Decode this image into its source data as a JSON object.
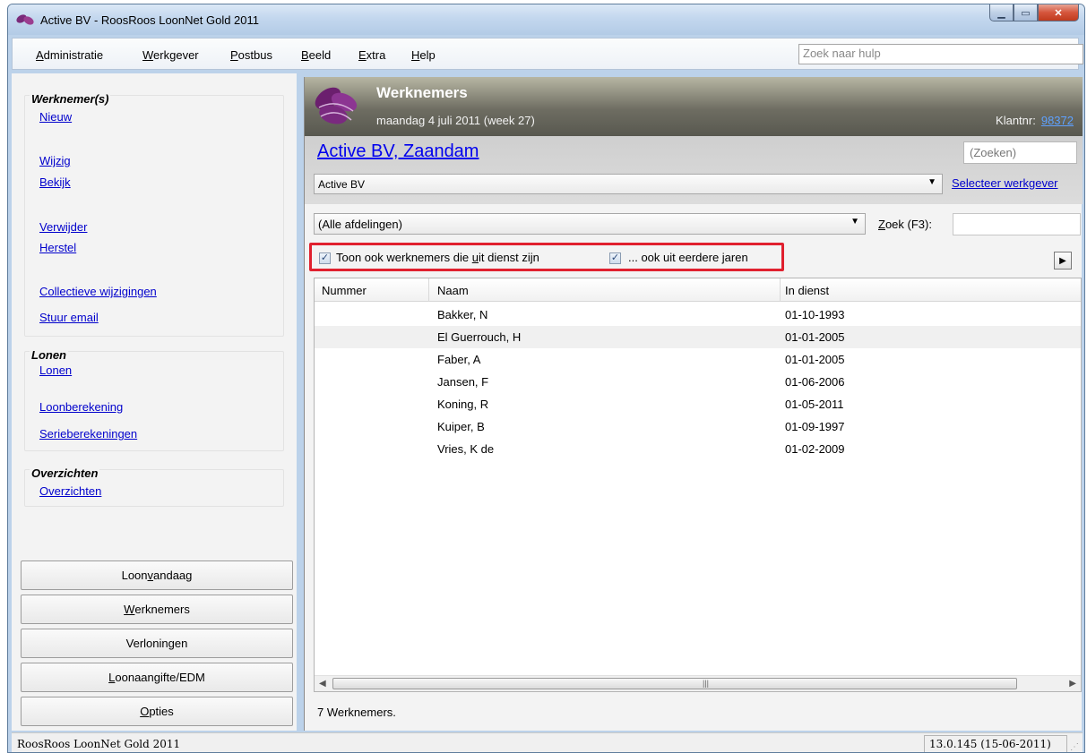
{
  "window": {
    "title": "Active BV - RoosRoos LoonNet Gold 2011"
  },
  "menu": {
    "items": [
      {
        "pre": "",
        "ul": "A",
        "post": "dministratie"
      },
      {
        "pre": "",
        "ul": "W",
        "post": "erkgever"
      },
      {
        "pre": "",
        "ul": "P",
        "post": "ostbus"
      },
      {
        "pre": "",
        "ul": "B",
        "post": "eeld"
      },
      {
        "pre": "",
        "ul": "E",
        "post": "xtra"
      },
      {
        "pre": "",
        "ul": "H",
        "post": "elp"
      }
    ],
    "help_search_placeholder": "Zoek naar hulp"
  },
  "sidebar": {
    "groups": {
      "werknemers": {
        "title": "Werknemer(s)",
        "links": [
          "Nieuw",
          "Wijzig",
          "Bekijk",
          "Verwijder",
          "Herstel",
          "Collectieve wijzigingen",
          "Stuur email"
        ]
      },
      "lonen": {
        "title": "Lonen",
        "links": [
          "Lonen",
          "Loonberekening",
          "Serieberekeningen"
        ]
      },
      "overzichten": {
        "title": "Overzichten",
        "links": [
          "Overzichten"
        ]
      }
    },
    "buttons": [
      {
        "pre": "Loon ",
        "ul": "v",
        "post": "andaag"
      },
      {
        "pre": "",
        "ul": "W",
        "post": "erknemers"
      },
      {
        "pre": "Verloningen",
        "ul": "",
        "post": ""
      },
      {
        "pre": "",
        "ul": "L",
        "post": "oonaangifte/EDM"
      },
      {
        "pre": "",
        "ul": "O",
        "post": "pties"
      }
    ]
  },
  "banner": {
    "title": "Werknemers",
    "date": "maandag 4 juli 2011 (week 27)",
    "klantnr_label": "Klantnr:",
    "klantnr": "98372"
  },
  "employer": {
    "name": "Active BV, Zaandam",
    "search_placeholder": "(Zoeken)",
    "selected": "Active BV",
    "select_link": "Selecteer werkgever"
  },
  "filter": {
    "department": "(Alle afdelingen)",
    "zoek_ul": "Z",
    "zoek_rest": "oek (F3):",
    "chk1_pre": "Toon ook werknemers die ",
    "chk1_ul": "u",
    "chk1_post": "it dienst zijn",
    "chk1_checked": true,
    "chk2_label": "... ook uit eerdere jaren",
    "chk2_checked": true
  },
  "grid": {
    "columns": [
      "Nummer",
      "Naam",
      "In dienst"
    ],
    "rows": [
      {
        "nummer": "",
        "naam": "Bakker, N",
        "in_dienst": "01-10-1993"
      },
      {
        "nummer": "",
        "naam": "El Guerrouch, H",
        "in_dienst": "01-01-2005"
      },
      {
        "nummer": "",
        "naam": "Faber, A",
        "in_dienst": "01-01-2005"
      },
      {
        "nummer": "",
        "naam": "Jansen, F",
        "in_dienst": "01-06-2006"
      },
      {
        "nummer": "",
        "naam": "Koning, R",
        "in_dienst": "01-05-2011"
      },
      {
        "nummer": "",
        "naam": "Kuiper, B",
        "in_dienst": "01-09-1997"
      },
      {
        "nummer": "",
        "naam": "Vries, K de",
        "in_dienst": "01-02-2009"
      }
    ],
    "count_text": "7 Werknemers."
  },
  "status": {
    "left": "RoosRoos LoonNet Gold 2011",
    "right": "13.0.145 (15-06-2011)"
  },
  "colors": {
    "highlight": "#e0202e",
    "link": "#0000cc",
    "banner": "#6e6d62"
  }
}
